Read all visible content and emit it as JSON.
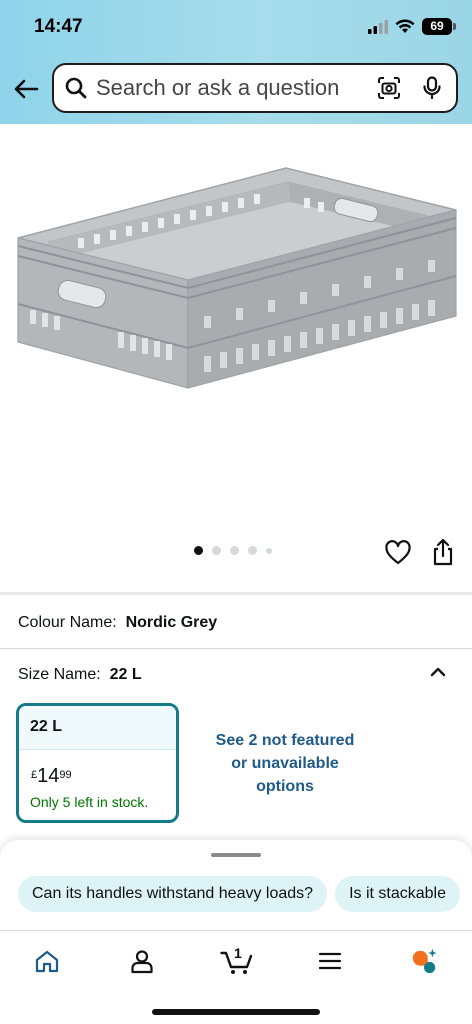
{
  "status_bar": {
    "time": "14:47",
    "battery": "69"
  },
  "search": {
    "placeholder": "Search or ask a question"
  },
  "gallery": {
    "image_count": 5,
    "active_index": 0
  },
  "colour": {
    "label": "Colour Name:",
    "value": "Nordic Grey"
  },
  "size": {
    "label": "Size Name:",
    "value": "22 L"
  },
  "size_option": {
    "name": "22 L",
    "currency": "£",
    "price_whole": "14",
    "price_fraction": "99",
    "stock": "Only 5 left in stock."
  },
  "more_options": {
    "line1": "See 2 not featured",
    "line2": "or unavailable",
    "line3": "options"
  },
  "suggestions": [
    "Can its handles withstand heavy loads?",
    "Is it stackable"
  ],
  "tabbar": {
    "items": [
      "home-icon",
      "account-icon",
      "cart-icon",
      "menu-icon",
      "rufus-icon"
    ],
    "cart_count": "1"
  },
  "colors": {
    "header_bg": "#a6dceb",
    "selected_border": "#157a8a",
    "link": "#1e5b8a",
    "in_stock": "#007600",
    "chip_bg": "#ddf3f6"
  }
}
